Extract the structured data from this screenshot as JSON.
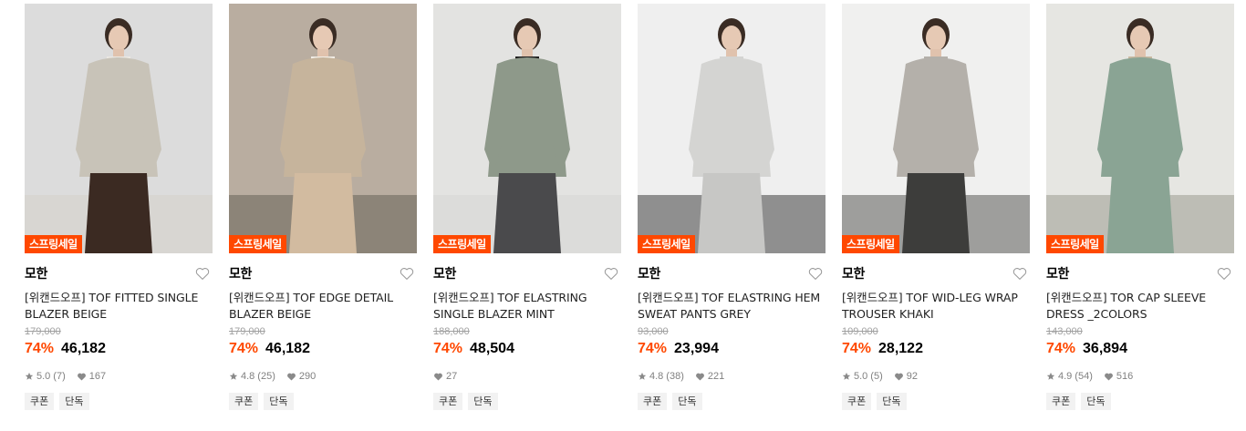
{
  "products": [
    {
      "badge": "스프링세일",
      "brand": "모한",
      "title": "[위캔드오프] TOF FITTED SINGLE BLAZER BEIGE",
      "original_price": "179,000",
      "discount": "74%",
      "price": "46,182",
      "rating": "5.0",
      "review_count": "(7)",
      "likes": "167",
      "tags": [
        "쿠폰",
        "단독"
      ],
      "image": {
        "bg": "#dcdcdc",
        "top": "#c8c3b8",
        "bottom": "#3b2a22",
        "inner": "#ebe8e2",
        "floor": "#d8d6d2"
      }
    },
    {
      "badge": "스프링세일",
      "brand": "모한",
      "title": "[위캔드오프] TOF EDGE DETAIL BLAZER BEIGE",
      "original_price": "179,000",
      "discount": "74%",
      "price": "46,182",
      "rating": "4.8",
      "review_count": "(25)",
      "likes": "290",
      "tags": [
        "쿠폰",
        "단독"
      ],
      "image": {
        "bg": "#b9ada0",
        "top": "#c6b49c",
        "bottom": "#d2bba0",
        "inner": "#f1ede6",
        "floor": "#8c8478"
      }
    },
    {
      "badge": "스프링세일",
      "brand": "모한",
      "title": "[위캔드오프] TOF ELASTRING SINGLE BLAZER MINT",
      "original_price": "188,000",
      "discount": "74%",
      "price": "48,504",
      "rating": "",
      "review_count": "",
      "likes": "27",
      "tags": [
        "쿠폰",
        "단독"
      ],
      "image": {
        "bg": "#e3e3e1",
        "top": "#8e998a",
        "bottom": "#4a4a4c",
        "inner": "#1e1e1e",
        "floor": "#dcdcda"
      }
    },
    {
      "badge": "스프링세일",
      "brand": "모한",
      "title": "[위캔드오프] TOF ELASTRING HEM SWEAT PANTS GREY",
      "original_price": "93,000",
      "discount": "74%",
      "price": "23,994",
      "rating": "4.8",
      "review_count": "(38)",
      "likes": "221",
      "tags": [
        "쿠폰",
        "단독"
      ],
      "image": {
        "bg": "#efefef",
        "top": "#d4d4d2",
        "bottom": "#c7c7c5",
        "inner": "#d4d4d2",
        "floor": "#8f8f8f"
      }
    },
    {
      "badge": "스프링세일",
      "brand": "모한",
      "title": "[위캔드오프] TOF WID-LEG WRAP TROUSER KHAKI",
      "original_price": "109,000",
      "discount": "74%",
      "price": "28,122",
      "rating": "5.0",
      "review_count": "(5)",
      "likes": "92",
      "tags": [
        "쿠폰",
        "단독"
      ],
      "image": {
        "bg": "#f0f0ef",
        "top": "#b4b0aa",
        "bottom": "#3d3d3b",
        "inner": "#b4b0aa",
        "floor": "#9e9e9c"
      }
    },
    {
      "badge": "스프링세일",
      "brand": "모한",
      "title": "[위캔드오프] TOR CAP SLEEVE DRESS _2COLORS",
      "original_price": "143,000",
      "discount": "74%",
      "price": "36,894",
      "rating": "4.9",
      "review_count": "(54)",
      "likes": "516",
      "tags": [
        "쿠폰",
        "단독"
      ],
      "image": {
        "bg": "#e6e6e2",
        "top": "#8aa494",
        "bottom": "#8aa494",
        "inner": "#c8b8a0",
        "floor": "#bdbdb5"
      }
    }
  ],
  "colors": {
    "accent": "#ff4800",
    "muted": "#808080",
    "strike": "#a0a0a0",
    "tag_bg": "#f2f2f2"
  },
  "icons": {
    "wishlist": "heart-outline-icon",
    "rating": "star-icon",
    "likes": "heart-filled-icon"
  }
}
